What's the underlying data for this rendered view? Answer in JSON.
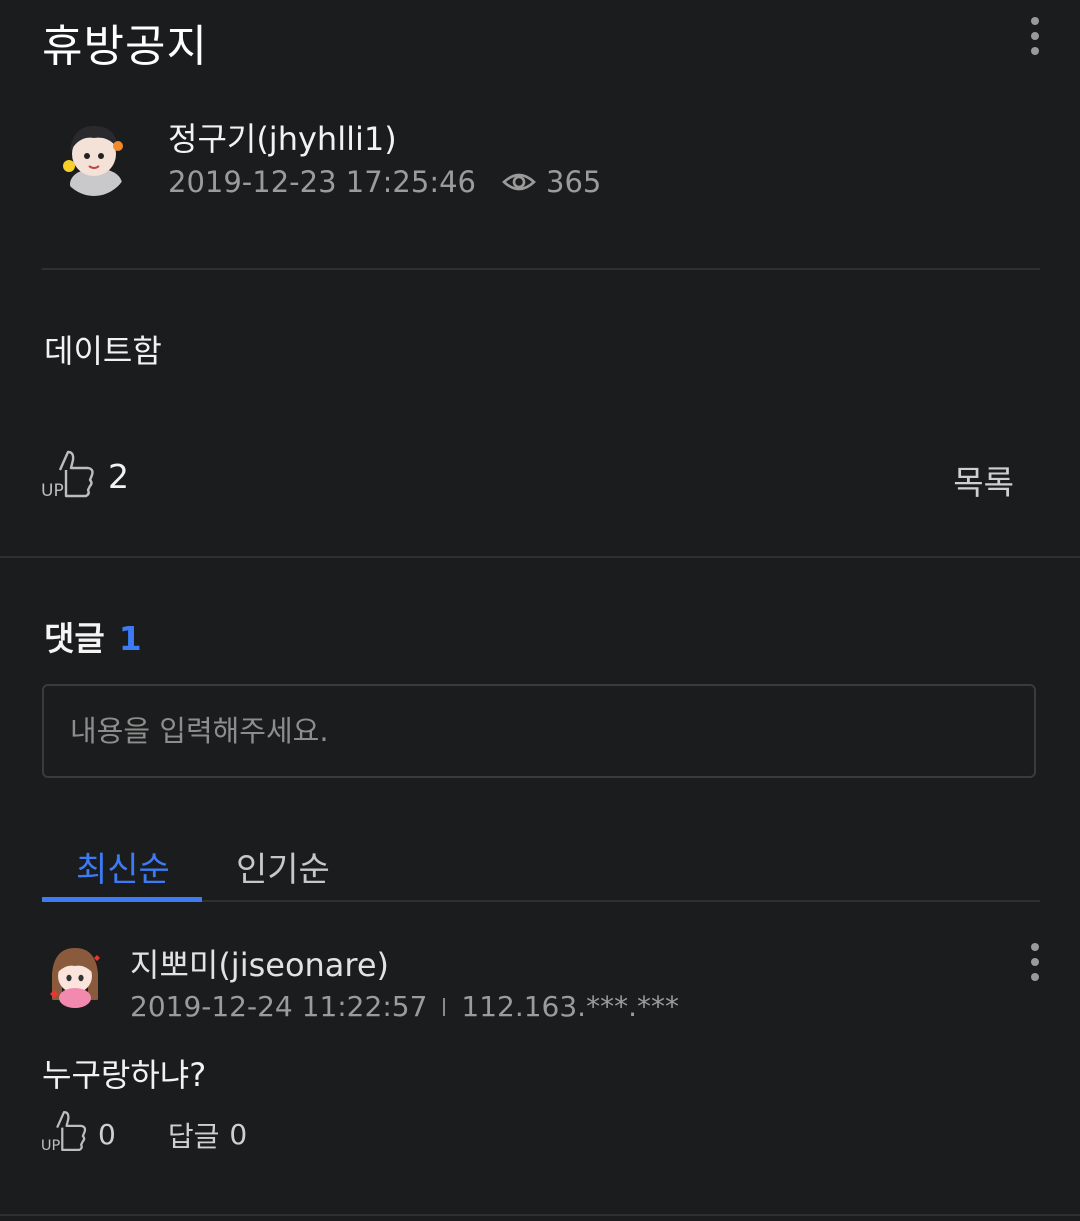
{
  "post": {
    "title": "휴방공지",
    "author": "정구기(jhyhlli1)",
    "datetime": "2019-12-23 17:25:46",
    "views": "365",
    "content": "데이트함",
    "likes": "2",
    "list_label": "목록"
  },
  "comments_section": {
    "heading": "댓글",
    "count": "1",
    "input_placeholder": "내용을 입력해주세요.",
    "tabs": [
      {
        "label": "최신순",
        "active": true
      },
      {
        "label": "인기순",
        "active": false
      }
    ]
  },
  "comments": [
    {
      "author": "지뽀미(jiseonare)",
      "datetime": "2019-12-24 11:22:57",
      "ip": "112.163.***.***",
      "text": "누구랑하냐?",
      "likes": "0",
      "reply_label": "답글",
      "replies": "0"
    }
  ],
  "colors": {
    "background": "#1b1c1d",
    "accent": "#3d7bf5",
    "divider": "#2f3032",
    "muted_text": "#9b9b9b"
  },
  "icons": [
    "more-vertical-icon",
    "eye-icon",
    "thumbs-up-icon"
  ]
}
